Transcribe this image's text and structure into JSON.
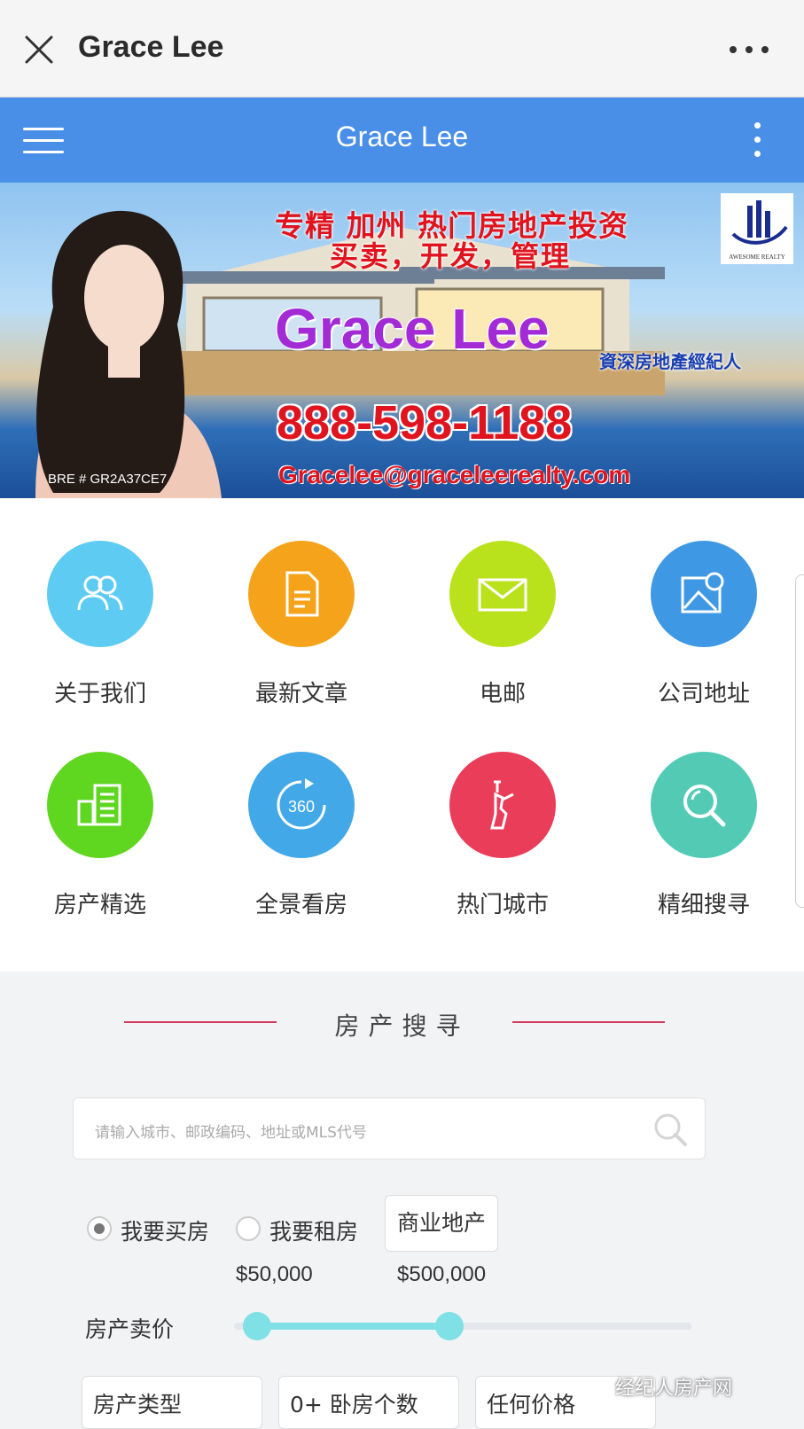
{
  "wechat_bar": {
    "title": "Grace Lee"
  },
  "app_bar": {
    "title": "Grace Lee"
  },
  "banner": {
    "line1": "专精 加州 热门房地产投资",
    "line2": "买卖，开发，管理",
    "name": "Grace Lee",
    "agent_title": "資深房地產經紀人",
    "phone": "888-598-1188",
    "email": "Gracelee@graceleerealty.com",
    "license": "BRE # GR2A37CE7",
    "logo_text": "AWESOME REALTY"
  },
  "menu_grid": [
    {
      "label": "关于我们",
      "icon": "people-icon",
      "color": "#5ecbf3"
    },
    {
      "label": "最新文章",
      "icon": "document-icon",
      "color": "#f5a31a"
    },
    {
      "label": "电邮",
      "icon": "mail-icon",
      "color": "#b9e21c"
    },
    {
      "label": "公司地址",
      "icon": "map-pin-icon",
      "color": "#3f98e3"
    },
    {
      "label": "房产精选",
      "icon": "buildings-icon",
      "color": "#5fd61f"
    },
    {
      "label": "全景看房",
      "icon": "panorama-360-icon",
      "color": "#43a8e8"
    },
    {
      "label": "热门城市",
      "icon": "statue-of-liberty-icon",
      "color": "#ea3d5a"
    },
    {
      "label": "精细搜寻",
      "icon": "search-icon",
      "color": "#53cbb4"
    }
  ],
  "property_search": {
    "title": "房产搜寻",
    "placeholder": "请输入城市、邮政编码、地址或MLS代号",
    "options": {
      "buy": "我要买房",
      "rent": "我要租房",
      "commercial": "商业地产",
      "selected": "buy"
    },
    "price_label": "房产卖价",
    "price_min": "$50,000",
    "price_max": "$500,000",
    "slider_min_fraction": 0.05,
    "slider_max_fraction": 0.47,
    "filters": [
      "房产类型",
      "0+ 卧房个数",
      "任何价格"
    ]
  },
  "watermark": "经纪人房产网",
  "colors": {
    "app_bar": "#4a8fe7",
    "accent_line": "#d23c5e",
    "slider": "#7fe0e6"
  }
}
